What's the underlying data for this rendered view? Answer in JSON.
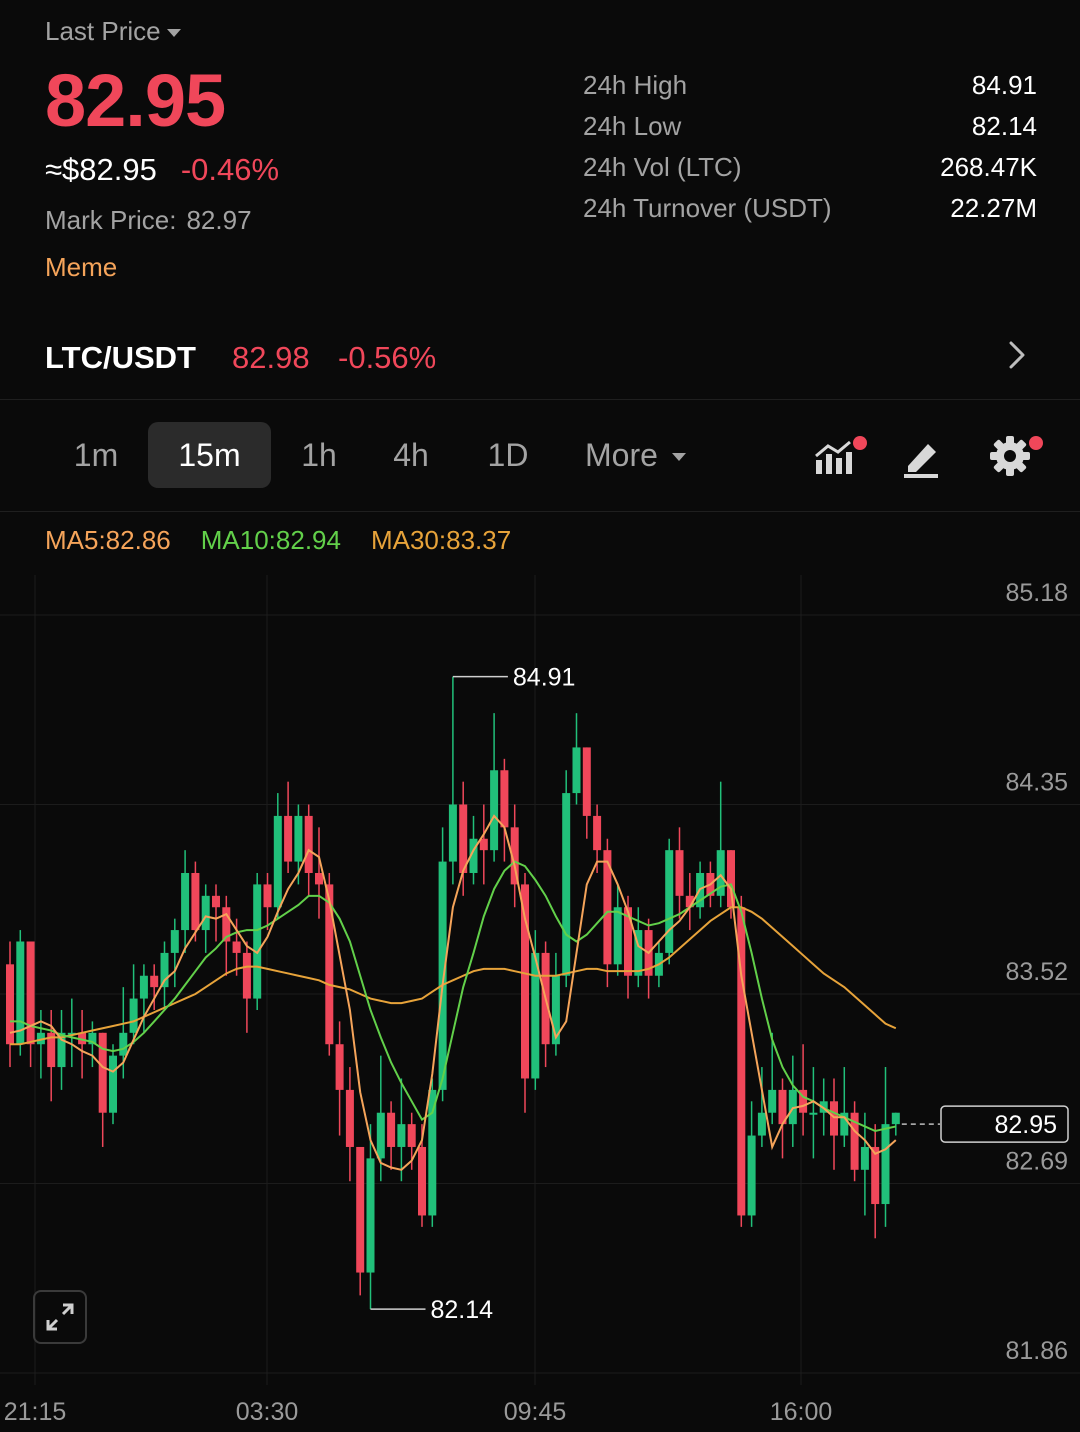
{
  "header": {
    "last_price_label": "Last Price",
    "last_price": "82.95",
    "usd_price": "≈$82.95",
    "change_pct": "-0.46%",
    "mark_price_label": "Mark Price:",
    "mark_price": "82.97",
    "tag": "Meme"
  },
  "stats": [
    {
      "label": "24h High",
      "value": "84.91"
    },
    {
      "label": "24h Low",
      "value": "82.14"
    },
    {
      "label": "24h Vol (LTC)",
      "value": "268.47K"
    },
    {
      "label": "24h Turnover (USDT)",
      "value": "22.27M"
    }
  ],
  "pair": {
    "name": "LTC/USDT",
    "price": "82.98",
    "change_pct": "-0.56%"
  },
  "timeframes": {
    "items": [
      "1m",
      "15m",
      "1h",
      "4h",
      "1D"
    ],
    "active": "15m",
    "more_label": "More"
  },
  "icons": {
    "indicator": "indicator-chart-icon",
    "draw": "pencil-draw-icon",
    "settings": "gear-icon",
    "expand": "expand-icon",
    "chevron": "chevron-right-icon"
  },
  "colors": {
    "up": "#21c07a",
    "down": "#f0475a",
    "ma5": "#f5a45a",
    "ma10": "#62d04a",
    "ma30": "#e7a33a",
    "accent": "#f5a45a"
  },
  "ma": {
    "ma5": "MA5:82.86",
    "ma10": "MA10:82.94",
    "ma30": "MA30:83.37"
  },
  "chart_data": {
    "type": "candlestick",
    "y_ticks": [
      "85.18",
      "84.35",
      "83.52",
      "82.69",
      "81.86"
    ],
    "x_ticks": [
      "21:15",
      "03:30",
      "09:45",
      "16:00"
    ],
    "ylim": [
      81.86,
      85.18
    ],
    "high_label": "84.91",
    "low_label": "82.14",
    "current_price": "82.95",
    "candles": [
      [
        83.65,
        83.3,
        83.75,
        83.2
      ],
      [
        83.3,
        83.75,
        83.8,
        83.25
      ],
      [
        83.75,
        83.3,
        83.75,
        83.2
      ],
      [
        83.3,
        83.35,
        83.45,
        83.15
      ],
      [
        83.35,
        83.2,
        83.45,
        83.05
      ],
      [
        83.2,
        83.35,
        83.45,
        83.1
      ],
      [
        83.35,
        83.35,
        83.5,
        83.2
      ],
      [
        83.35,
        83.3,
        83.45,
        83.15
      ],
      [
        83.3,
        83.35,
        83.4,
        83.2
      ],
      [
        83.35,
        83.0,
        83.35,
        82.85
      ],
      [
        83.0,
        83.25,
        83.3,
        82.95
      ],
      [
        83.25,
        83.35,
        83.55,
        83.15
      ],
      [
        83.35,
        83.5,
        83.65,
        83.3
      ],
      [
        83.5,
        83.6,
        83.65,
        83.35
      ],
      [
        83.6,
        83.55,
        83.65,
        83.45
      ],
      [
        83.55,
        83.7,
        83.75,
        83.45
      ],
      [
        83.7,
        83.8,
        83.85,
        83.55
      ],
      [
        83.8,
        84.05,
        84.15,
        83.7
      ],
      [
        84.05,
        83.8,
        84.1,
        83.75
      ],
      [
        83.8,
        83.95,
        84.0,
        83.7
      ],
      [
        83.95,
        83.9,
        84.0,
        83.75
      ],
      [
        83.9,
        83.75,
        83.95,
        83.6
      ],
      [
        83.75,
        83.7,
        83.85,
        83.6
      ],
      [
        83.7,
        83.5,
        83.75,
        83.35
      ],
      [
        83.5,
        84.0,
        84.05,
        83.45
      ],
      [
        84.0,
        83.9,
        84.05,
        83.8
      ],
      [
        83.9,
        84.3,
        84.4,
        83.85
      ],
      [
        84.3,
        84.1,
        84.45,
        84.05
      ],
      [
        84.1,
        84.3,
        84.35,
        84.0
      ],
      [
        84.3,
        84.05,
        84.35,
        83.95
      ],
      [
        84.05,
        84.0,
        84.25,
        83.85
      ],
      [
        84.0,
        83.3,
        84.05,
        83.25
      ],
      [
        83.3,
        83.1,
        83.4,
        82.9
      ],
      [
        83.1,
        82.85,
        83.2,
        82.7
      ],
      [
        82.85,
        82.3,
        82.85,
        82.2
      ],
      [
        82.3,
        82.8,
        82.95,
        82.14
      ],
      [
        82.8,
        83.0,
        83.25,
        82.7
      ],
      [
        83.0,
        82.85,
        83.05,
        82.75
      ],
      [
        82.85,
        82.95,
        83.15,
        82.7
      ],
      [
        82.95,
        82.85,
        83.0,
        82.75
      ],
      [
        82.85,
        82.55,
        82.95,
        82.5
      ],
      [
        82.55,
        83.1,
        83.15,
        82.5
      ],
      [
        83.1,
        84.1,
        84.25,
        83.05
      ],
      [
        84.1,
        84.35,
        84.91,
        84.0
      ],
      [
        84.35,
        84.05,
        84.45,
        83.95
      ],
      [
        84.05,
        84.2,
        84.3,
        84.0
      ],
      [
        84.2,
        84.15,
        84.35,
        84.0
      ],
      [
        84.15,
        84.5,
        84.75,
        84.1
      ],
      [
        84.5,
        84.25,
        84.55,
        84.1
      ],
      [
        84.25,
        84.0,
        84.35,
        83.9
      ],
      [
        84.0,
        83.15,
        84.05,
        83.0
      ],
      [
        83.15,
        83.7,
        83.8,
        83.1
      ],
      [
        83.7,
        83.3,
        83.75,
        83.2
      ],
      [
        83.3,
        83.6,
        83.7,
        83.25
      ],
      [
        83.6,
        84.4,
        84.5,
        83.55
      ],
      [
        84.4,
        84.6,
        84.75,
        84.35
      ],
      [
        84.6,
        84.3,
        84.6,
        84.2
      ],
      [
        84.3,
        84.15,
        84.35,
        84.05
      ],
      [
        84.15,
        83.65,
        84.2,
        83.55
      ],
      [
        83.65,
        83.9,
        84.0,
        83.6
      ],
      [
        83.9,
        83.6,
        83.95,
        83.5
      ],
      [
        83.6,
        83.8,
        83.9,
        83.55
      ],
      [
        83.8,
        83.6,
        83.85,
        83.5
      ],
      [
        83.6,
        83.7,
        83.75,
        83.55
      ],
      [
        83.7,
        84.15,
        84.2,
        83.65
      ],
      [
        84.15,
        83.95,
        84.25,
        83.85
      ],
      [
        83.95,
        83.9,
        84.05,
        83.8
      ],
      [
        83.9,
        84.05,
        84.1,
        83.85
      ],
      [
        84.05,
        83.95,
        84.1,
        83.9
      ],
      [
        83.95,
        84.15,
        84.45,
        83.9
      ],
      [
        84.15,
        83.9,
        84.15,
        83.85
      ],
      [
        83.9,
        82.55,
        83.95,
        82.5
      ],
      [
        82.55,
        82.9,
        83.05,
        82.5
      ],
      [
        82.9,
        83.0,
        83.2,
        82.85
      ],
      [
        83.0,
        83.1,
        83.35,
        82.95
      ],
      [
        83.1,
        82.95,
        83.15,
        82.8
      ],
      [
        82.95,
        83.1,
        83.25,
        82.85
      ],
      [
        83.1,
        83.0,
        83.3,
        82.9
      ],
      [
        83.0,
        83.0,
        83.2,
        82.8
      ],
      [
        83.0,
        83.05,
        83.15,
        82.9
      ],
      [
        83.05,
        82.9,
        83.15,
        82.75
      ],
      [
        82.9,
        83.0,
        83.2,
        82.85
      ],
      [
        83.0,
        82.75,
        83.05,
        82.7
      ],
      [
        82.75,
        82.85,
        83.0,
        82.55
      ],
      [
        82.85,
        82.6,
        82.95,
        82.45
      ],
      [
        82.6,
        82.95,
        83.2,
        82.5
      ],
      [
        82.95,
        83.0,
        83.0,
        82.9
      ]
    ],
    "ma5": [
      83.35,
      83.36,
      83.38,
      83.4,
      83.38,
      83.32,
      83.3,
      83.27,
      83.25,
      83.2,
      83.18,
      83.22,
      83.32,
      83.42,
      83.5,
      83.58,
      83.62,
      83.72,
      83.79,
      83.86,
      83.85,
      83.87,
      83.8,
      83.73,
      83.7,
      83.77,
      83.88,
      83.98,
      84.05,
      84.15,
      84.12,
      83.93,
      83.69,
      83.45,
      83.09,
      82.88,
      82.78,
      82.76,
      82.75,
      82.79,
      82.88,
      83.17,
      83.56,
      83.9,
      84.06,
      84.15,
      84.22,
      84.3,
      84.25,
      84.08,
      83.85,
      83.68,
      83.5,
      83.33,
      83.4,
      83.7,
      84.0,
      84.1,
      84.1,
      84.0,
      83.88,
      83.73,
      83.7,
      83.75,
      83.8,
      83.84,
      83.9,
      83.98,
      84.0,
      84.04,
      83.98,
      83.6,
      83.35,
      83.1,
      82.85,
      82.95,
      83.02,
      83.03,
      83.05,
      83.02,
      82.98,
      82.98,
      82.92,
      82.88,
      82.82,
      82.84,
      82.88
    ],
    "ma10": [
      83.4,
      83.4,
      83.38,
      83.37,
      83.36,
      83.34,
      83.33,
      83.32,
      83.31,
      83.28,
      83.27,
      83.28,
      83.31,
      83.35,
      83.4,
      83.45,
      83.5,
      83.56,
      83.62,
      83.68,
      83.72,
      83.77,
      83.79,
      83.8,
      83.8,
      83.82,
      83.85,
      83.88,
      83.91,
      83.95,
      83.95,
      83.92,
      83.85,
      83.75,
      83.6,
      83.45,
      83.33,
      83.22,
      83.13,
      83.05,
      82.97,
      83.0,
      83.15,
      83.35,
      83.55,
      83.7,
      83.86,
      83.98,
      84.06,
      84.1,
      84.08,
      84.02,
      83.95,
      83.86,
      83.78,
      83.75,
      83.78,
      83.83,
      83.88,
      83.88,
      83.86,
      83.84,
      83.82,
      83.83,
      83.85,
      83.87,
      83.9,
      83.93,
      83.96,
      83.99,
      84.0,
      83.88,
      83.7,
      83.5,
      83.32,
      83.2,
      83.12,
      83.07,
      83.05,
      83.02,
      83.0,
      82.98,
      82.96,
      82.94,
      82.92,
      82.93,
      82.94
    ],
    "ma30": [
      83.3,
      83.3,
      83.31,
      83.32,
      83.33,
      83.33,
      83.34,
      83.35,
      83.36,
      83.37,
      83.38,
      83.39,
      83.4,
      83.42,
      83.44,
      83.46,
      83.48,
      83.5,
      83.52,
      83.55,
      83.58,
      83.61,
      83.63,
      83.64,
      83.64,
      83.63,
      83.62,
      83.61,
      83.6,
      83.59,
      83.58,
      83.56,
      83.55,
      83.54,
      83.52,
      83.5,
      83.49,
      83.48,
      83.48,
      83.49,
      83.5,
      83.53,
      83.56,
      83.58,
      83.6,
      83.62,
      83.63,
      83.63,
      83.63,
      83.62,
      83.61,
      83.6,
      83.6,
      83.6,
      83.61,
      83.62,
      83.63,
      83.63,
      83.62,
      83.62,
      83.62,
      83.62,
      83.63,
      83.65,
      83.68,
      83.72,
      83.76,
      83.8,
      83.84,
      83.87,
      83.9,
      83.9,
      83.88,
      83.85,
      83.81,
      83.77,
      83.73,
      83.69,
      83.65,
      83.61,
      83.58,
      83.55,
      83.51,
      83.47,
      83.43,
      83.39,
      83.37
    ]
  }
}
